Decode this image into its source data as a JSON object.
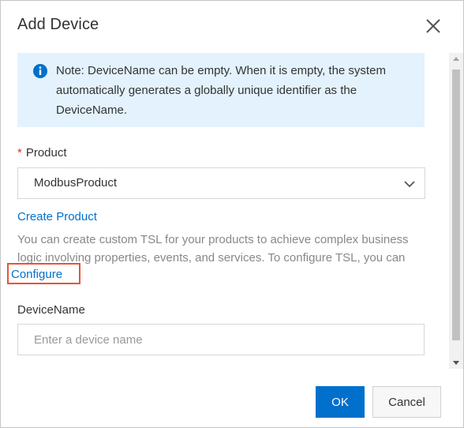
{
  "dialog": {
    "title": "Add Device",
    "close_icon": "close-icon"
  },
  "note": {
    "icon": "info-icon",
    "text": "Note: DeviceName can be empty. When it is empty, the system automatically generates a globally unique identifier as the DeviceName."
  },
  "product": {
    "required_mark": "*",
    "label": "Product",
    "selected_value": "ModbusProduct",
    "dropdown_icon": "chevron-down-icon",
    "create_link": "Create Product",
    "help_text": "You can create custom TSL for your products to achieve complex business logic involving properties, events, and services. To configure TSL, you can",
    "configure_link": "Configure"
  },
  "device_name": {
    "label": "DeviceName",
    "placeholder": "Enter a device name",
    "value": ""
  },
  "footer": {
    "ok_label": "OK",
    "cancel_label": "Cancel"
  },
  "colors": {
    "primary": "#0070cc",
    "note_background": "#e3f2fd",
    "required": "#d93026",
    "highlight_box": "#e8533a"
  }
}
